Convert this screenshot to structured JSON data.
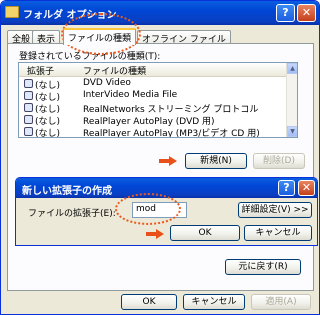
{
  "window": {
    "title": "フォルダ オプション",
    "help_glyph": "?",
    "close_glyph": "✕"
  },
  "tabs": [
    {
      "label": "全般",
      "active": false
    },
    {
      "label": "表示",
      "active": false
    },
    {
      "label": "ファイルの種類",
      "active": true
    },
    {
      "label": "オフライン ファイル",
      "active": false
    }
  ],
  "registered_label": "登録されているファイルの種類(T):",
  "list": {
    "columns": [
      "拡張子",
      "ファイルの種類"
    ],
    "rows": [
      {
        "ext": "(なし)",
        "type": "DVD Video"
      },
      {
        "ext": "(なし)",
        "type": "InterVideo Media File"
      },
      {
        "ext": "(なし)",
        "type": "RealNetworks ストリーミング プロトコル"
      },
      {
        "ext": "(なし)",
        "type": "RealPlayer AutoPlay (DVD 用)"
      },
      {
        "ext": "(なし)",
        "type": "RealPlayer AutoPlay (MP3/ビデオ CD 用)"
      }
    ]
  },
  "buttons": {
    "new": "新規(N)",
    "delete": "削除(D)",
    "restore": "元に戻す(R)",
    "ok": "OK",
    "cancel": "キャンセル",
    "apply": "適用(A)"
  },
  "dialog": {
    "title": "新しい拡張子の作成",
    "field_label": "ファイルの拡張子(E):",
    "field_value": "mod",
    "advanced": "詳細設定(V) >>",
    "ok": "OK",
    "cancel": "キャンセル",
    "help_glyph": "?",
    "close_glyph": "✕"
  },
  "colors": {
    "titlebar": "#0046d5",
    "annotation": "#ea5a1d",
    "face": "#ece9d8"
  }
}
